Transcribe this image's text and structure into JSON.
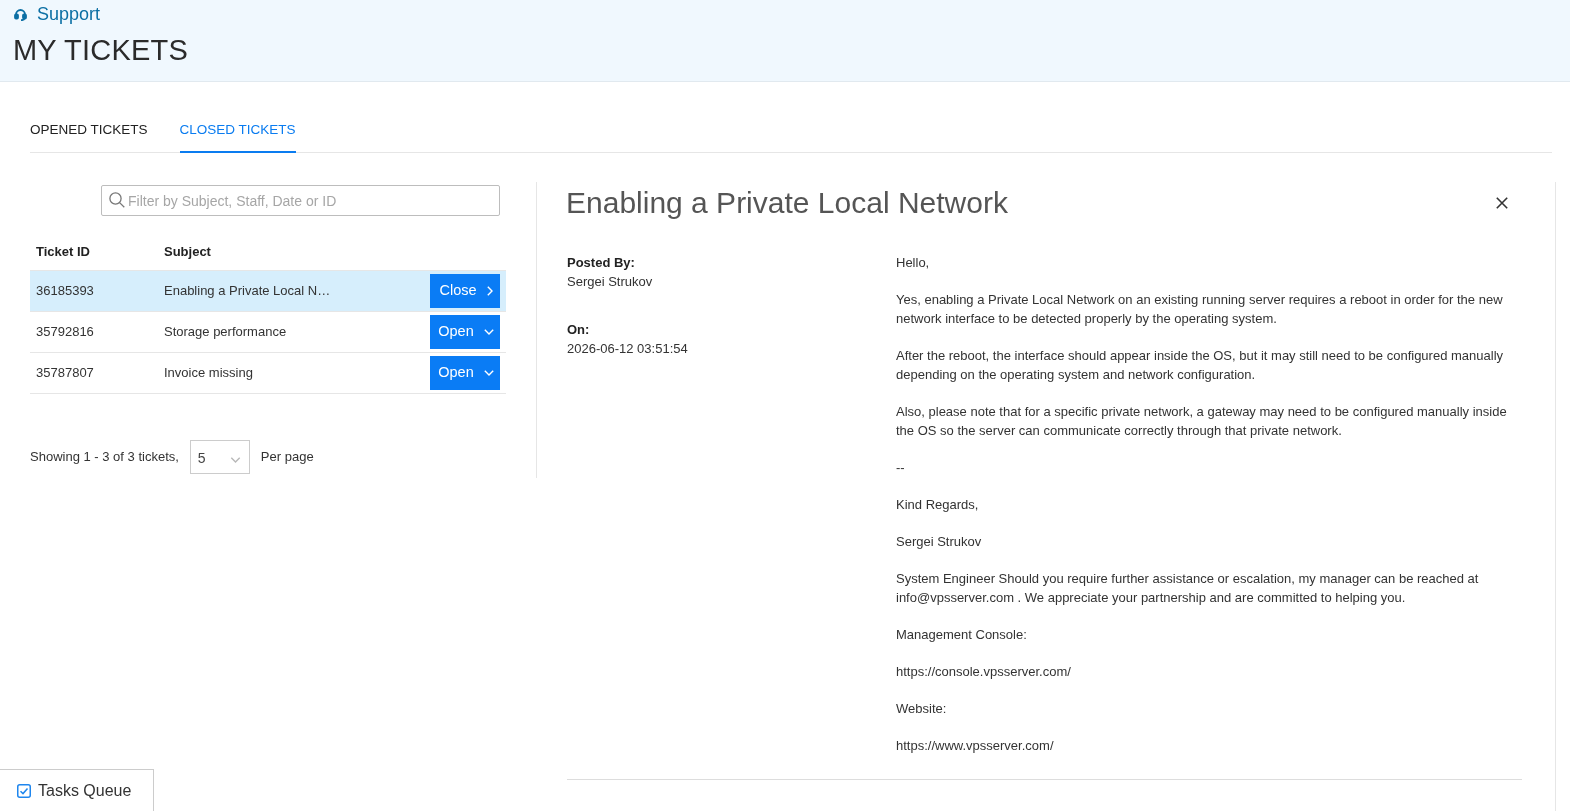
{
  "header": {
    "section": "Support",
    "title": "MY TICKETS"
  },
  "tabs": [
    {
      "label": "OPENED TICKETS",
      "selected": false
    },
    {
      "label": "CLOSED TICKETS",
      "selected": true
    }
  ],
  "ticket_list": {
    "search": {
      "placeholder": "Filter by Subject, Staff, Date or ID"
    },
    "columns": [
      "Ticket ID",
      "Subject"
    ],
    "rows": [
      {
        "ticket_id": "36185393",
        "subject": "Enabling a Private Local N…",
        "selected": true,
        "action": {
          "label": "Close",
          "kind": "close"
        }
      },
      {
        "ticket_id": "35792816",
        "subject": "Storage performance",
        "selected": false,
        "action": {
          "label": "Open",
          "kind": "open"
        }
      },
      {
        "ticket_id": "35787807",
        "subject": "Invoice missing",
        "selected": false,
        "action": {
          "label": "Open",
          "kind": "open"
        }
      }
    ],
    "pagination": {
      "summary": "Showing 1 - 3 of 3 tickets,",
      "per_page": "5",
      "per_page_label": "Per page"
    }
  },
  "ticket_detail": {
    "title": "Enabling a Private Local Network",
    "posts": [
      {
        "posted_by_label": "Posted By:",
        "author": "Sergei Strukov",
        "on_label": "On:",
        "date": "2026-06-12 03:51:54",
        "paragraphs": [
          "Hello,",
          "Yes, enabling a Private Local Network on an existing running server requires a reboot in order for the new network interface to be detected properly by the operating system.",
          "After the reboot, the interface should appear inside the OS, but it may still need to be configured manually depending on the operating system and network configuration.",
          "Also, please note that for a specific private network, a gateway may need to be configured manually inside the OS so the server can communicate correctly through that private network.",
          "--",
          "Kind Regards,",
          "Sergei Strukov",
          "System Engineer Should you require further assistance or escalation, my manager can be reached at info@vpsserver.com . We appreciate your partnership and are committed to helping you.",
          "Management Console:",
          "https://console.vpsserver.com/",
          "Website:",
          "https://www.vpsserver.com/"
        ]
      }
    ]
  },
  "tasks_queue": {
    "label": "Tasks Queue",
    "checked": true
  }
}
